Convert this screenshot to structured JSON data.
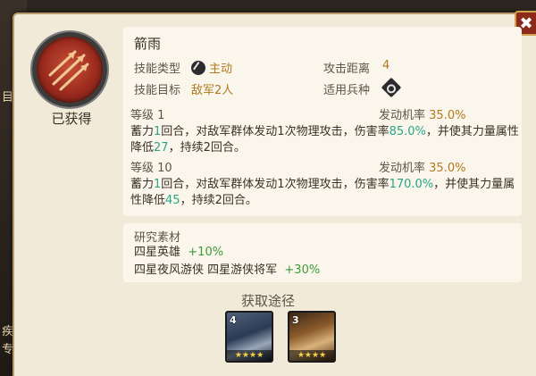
{
  "window": {
    "close_label": "✖"
  },
  "skill": {
    "name": "箭雨",
    "status": "已获得",
    "type_label": "技能类型",
    "type_value": "主动",
    "range_label": "攻击距离",
    "range_value": "4",
    "target_label": "技能目标",
    "target_value": "敌军2人",
    "unit_label": "适用兵种"
  },
  "levels": [
    {
      "level_label": "等级",
      "level_value": "1",
      "chance_label": "发动机率",
      "chance_value": "35.0%",
      "desc": {
        "p1": "蓄力",
        "n1": "1",
        "p2": "回合，对敌军群体发动1次物理攻击，伤害率",
        "n2": "85.0%",
        "p3": "，并使其力量属性降低",
        "n3": "27",
        "p4": "，持续2回合。"
      }
    },
    {
      "level_label": "等级",
      "level_value": "10",
      "chance_label": "发动机率",
      "chance_value": "35.0%",
      "desc": {
        "p1": "蓄力",
        "n1": "1",
        "p2": "回合，对敌军群体发动1次物理攻击，伤害率",
        "n2": "170.0%",
        "p3": "，并使其力量属性降低",
        "n3": "45",
        "p4": "，持续2回合。"
      }
    }
  ],
  "research": {
    "title": "研究素材",
    "row1_label": "四星英雄",
    "row1_bonus": "+10%",
    "row2_label": "四星夜风游侠 四星游侠将军",
    "row2_bonus": "+30%"
  },
  "acquire": {
    "title": "获取途径",
    "heroes": [
      {
        "stage": "4",
        "stars": "★★★★"
      },
      {
        "stage": "3",
        "stars": "★★★★"
      }
    ]
  },
  "side_deco": [
    "目",
    "疾",
    "专"
  ],
  "colors": {
    "accent_gold": "#b07a1e",
    "accent_green": "#3c9a3a",
    "accent_teal": "#2aa586",
    "close_red": "#8b2a1a"
  }
}
